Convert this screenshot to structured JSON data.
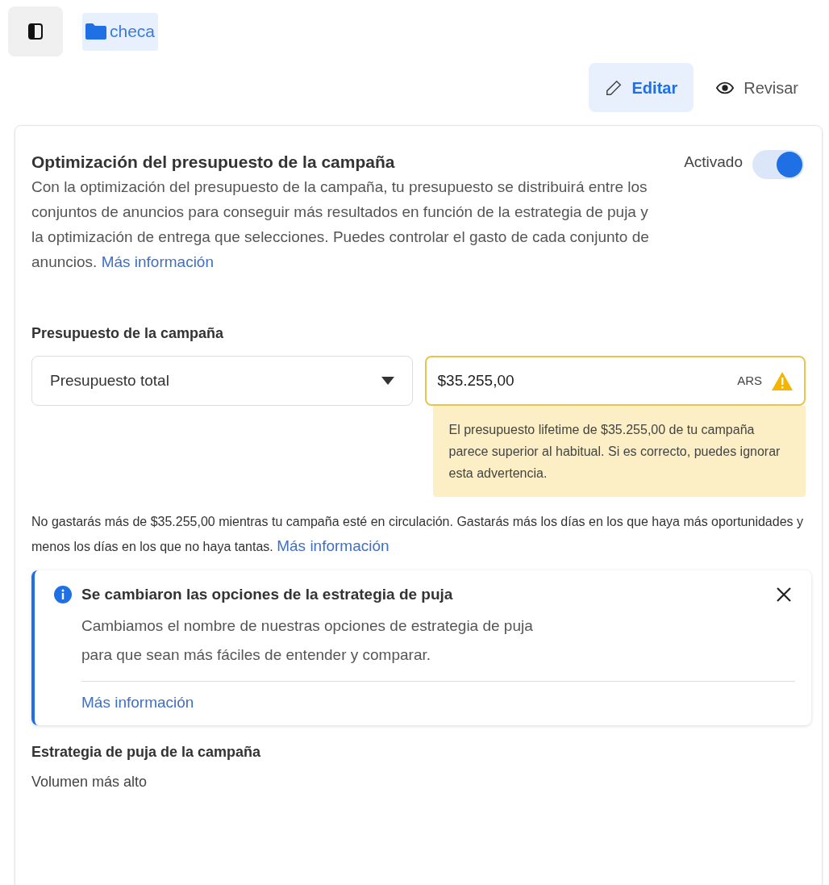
{
  "breadcrumb": {
    "folder": "checa"
  },
  "modes": [
    {
      "label": "Editar",
      "kind": "edit",
      "selected": true
    },
    {
      "label": "Revisar",
      "kind": "review",
      "selected": false
    }
  ],
  "cbo": {
    "title": "Optimización del presupuesto de la campaña",
    "toggle_label": "Activado",
    "on": true,
    "description": "Con la optimización del presupuesto de la campaña, tu presupuesto se distribuirá entre los conjuntos de anuncios para conseguir más resultados en función de la estrategia de puja y la optimización de entrega que selecciones. Puedes controlar el gasto de cada conjunto de anuncios.",
    "link": "Más información"
  },
  "budget": {
    "label": "Presupuesto de la campaña",
    "type": "Presupuesto total",
    "amount": "$35.255,00",
    "currency": "ARS",
    "warning": "El presupuesto lifetime de $35.255,00 de tu campaña parece superior al habitual. Si es correcto, puedes ignorar esta advertencia.",
    "note": "No gastarás más de $35.255,00 mientras tu campaña esté en circulación. Gastarás más los días en los que haya más oportunidades y menos los días en los que no haya tantas.",
    "note_link": "Más información"
  },
  "notice": {
    "title": "Se cambiaron las opciones de la estrategia de puja",
    "body": "Cambiamos el nombre de nuestras opciones de estrategia de puja para que sean más fáciles de entender y comparar.",
    "link": "Más información"
  },
  "strategy": {
    "label": "Estrategia de puja de la campaña",
    "value": "Volumen más alto"
  }
}
